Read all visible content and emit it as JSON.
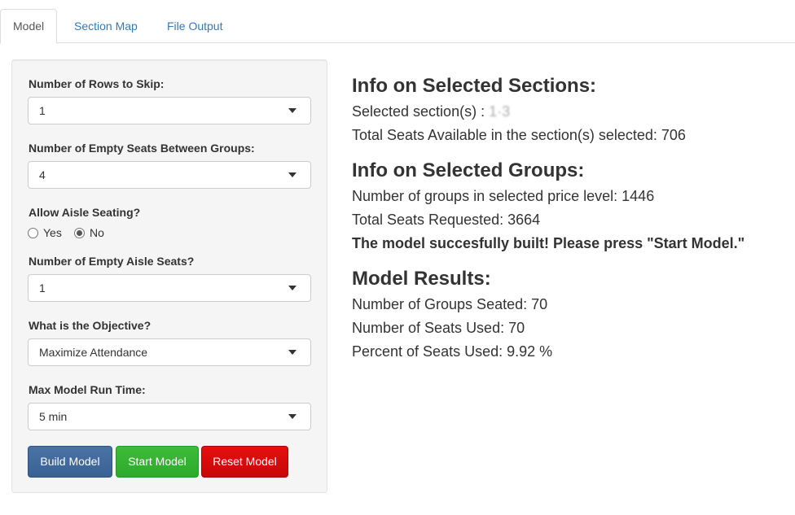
{
  "tabs": [
    {
      "label": "Model",
      "active": true
    },
    {
      "label": "Section Map",
      "active": false
    },
    {
      "label": "File Output",
      "active": false
    }
  ],
  "sidebar": {
    "rows_to_skip": {
      "label": "Number of Rows to Skip:",
      "value": "1"
    },
    "empty_seats": {
      "label": "Number of Empty Seats Between Groups:",
      "value": "4"
    },
    "aisle_seating": {
      "label": "Allow Aisle Seating?",
      "options": [
        "Yes",
        "No"
      ],
      "selected": "No"
    },
    "empty_aisle": {
      "label": "Number of Empty Aisle Seats?",
      "value": "1"
    },
    "objective": {
      "label": "What is the Objective?",
      "value": "Maximize Attendance"
    },
    "max_run_time": {
      "label": "Max Model Run Time:",
      "value": "5 min"
    },
    "buttons": {
      "build": "Build Model",
      "start": "Start Model",
      "reset": "Reset Model"
    },
    "colors": {
      "build": "#3f6a9e",
      "start": "#35b131",
      "reset": "#d70d0c"
    }
  },
  "main": {
    "sections": {
      "heading": "Info on Selected Sections:",
      "selected_prefix": "Selected section(s) :",
      "selected_value": "1·3",
      "total_seats": "Total Seats Available in the section(s) selected: 706"
    },
    "groups": {
      "heading": "Info on Selected Groups:",
      "num_groups": "Number of groups in selected price level: 1446",
      "seats_requested": "Total Seats Requested: 3664",
      "message": "The model succesfully built! Please press \"Start Model.\""
    },
    "results": {
      "heading": "Model Results:",
      "groups_seated": "Number of Groups Seated: 70",
      "seats_used": "Number of Seats Used: 70",
      "percent_used": "Percent of Seats Used: 9.92 %"
    }
  }
}
